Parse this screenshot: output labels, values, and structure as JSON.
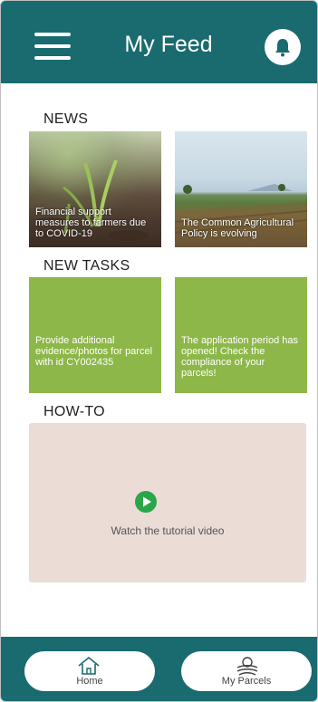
{
  "header": {
    "title": "My Feed",
    "menu_icon": "hamburger-menu-icon",
    "notification_icon": "bell-icon"
  },
  "news": {
    "heading": "NEWS",
    "items": [
      {
        "caption": "Financial support measures to farmers due to COVID-19"
      },
      {
        "caption": "The Common Agricultural Policy is evolving"
      }
    ]
  },
  "tasks": {
    "heading": "NEW TASKS",
    "items": [
      {
        "caption": "Provide additional evidence/photos for parcel with id CY002435"
      },
      {
        "caption": "The application period has opened! Check the compliance of your parcels!"
      }
    ]
  },
  "howto": {
    "heading": "HOW-TO",
    "video_label": "Watch the tutorial video",
    "play_icon": "play-icon"
  },
  "footer": {
    "home_label": "Home",
    "parcels_label": "My Parcels",
    "home_icon": "home-icon",
    "parcels_icon": "parcels-icon"
  },
  "colors": {
    "primary": "#1a6b6f",
    "task_card": "#8db748",
    "howto_bg": "#ebdcd6",
    "play": "#2aa64a"
  }
}
